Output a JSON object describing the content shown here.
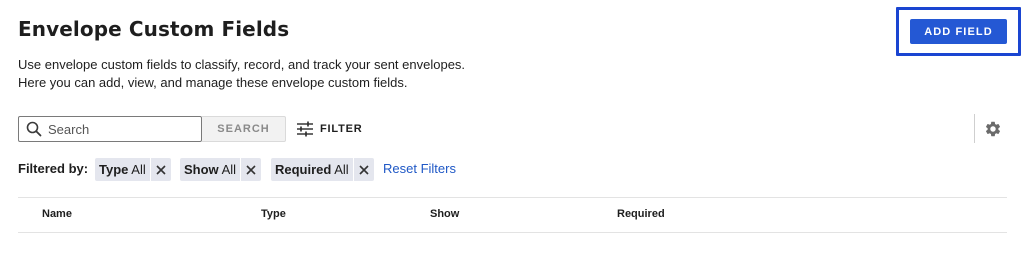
{
  "header": {
    "title": "Envelope Custom Fields",
    "add_button_label": "ADD FIELD"
  },
  "description": {
    "line1": "Use envelope custom fields to classify, record, and track your sent envelopes.",
    "line2": "Here you can add, view, and manage these envelope custom fields."
  },
  "toolbar": {
    "search_placeholder": "Search",
    "search_value": "",
    "search_button_label": "SEARCH",
    "filter_button_label": "FILTER",
    "settings_icon": "gear-icon"
  },
  "filters": {
    "label": "Filtered by:",
    "chips": [
      {
        "name": "Type",
        "value": "All"
      },
      {
        "name": "Show",
        "value": "All"
      },
      {
        "name": "Required",
        "value": "All"
      }
    ],
    "reset_label": "Reset Filters"
  },
  "table": {
    "columns": [
      "Name",
      "Type",
      "Show",
      "Required"
    ],
    "rows": []
  },
  "colors": {
    "primary": "#2458d4",
    "focus_ring": "#1a45d1",
    "link": "#1f58c6",
    "chip_bg": "#e4e6ee"
  }
}
